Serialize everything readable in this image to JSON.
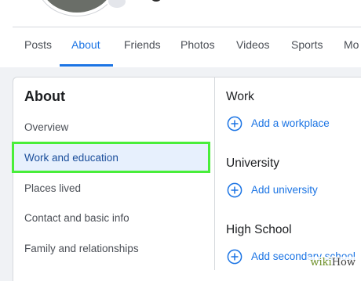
{
  "tabs": [
    "Posts",
    "About",
    "Friends",
    "Photos",
    "Videos",
    "Sports",
    "Mo"
  ],
  "active_tab": "About",
  "about": {
    "title": "About",
    "nav": [
      "Overview",
      "Work and education",
      "Places lived",
      "Contact and basic info",
      "Family and relationships"
    ],
    "selected": "Work and education"
  },
  "sections": [
    {
      "heading": "Work",
      "action": "Add a workplace",
      "icon": "plus-circle-icon"
    },
    {
      "heading": "University",
      "action": "Add university",
      "icon": "plus-circle-icon"
    },
    {
      "heading": "High School",
      "action": "Add secondary school",
      "icon": "plus-circle-icon"
    }
  ],
  "watermark": {
    "wiki": "wiki",
    "how": "How"
  },
  "colors": {
    "accent": "#1b74e4",
    "highlight": "#49ee3a",
    "selected_bg": "#e7f0fd"
  }
}
